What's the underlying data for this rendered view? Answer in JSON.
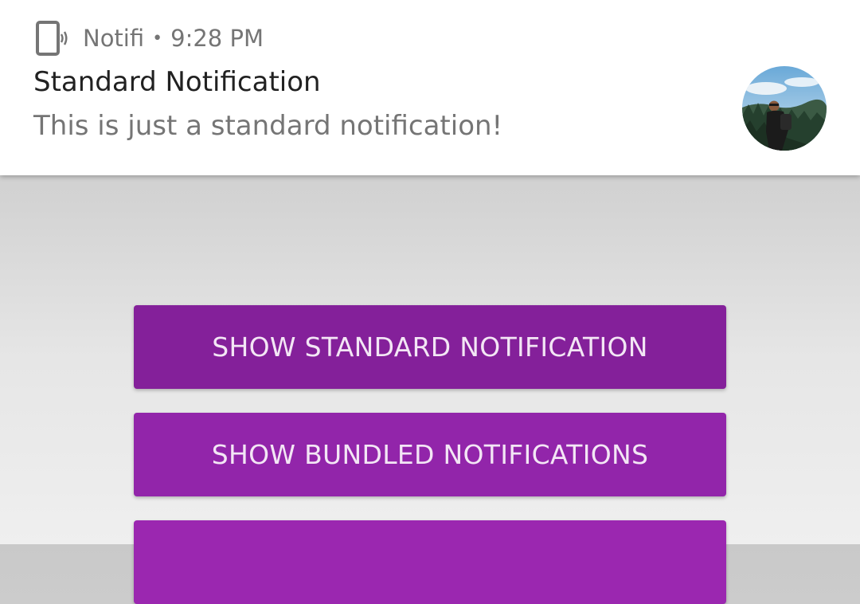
{
  "notification": {
    "app_name": "Notifi",
    "separator": "•",
    "time": "9:28 PM",
    "title": "Standard Notification",
    "text": "This is just a standard notification!",
    "app_icon": "phone-vibrate-icon",
    "large_icon": "avatar-photo"
  },
  "buttons": [
    {
      "label": "SHOW STANDARD NOTIFICATION"
    },
    {
      "label": "SHOW BUNDLED NOTIFICATIONS"
    },
    {
      "label": ""
    }
  ],
  "colors": {
    "button_primary": "#9b27b0",
    "notification_background": "#ffffff",
    "secondary_text": "#757575",
    "primary_text": "#212121"
  }
}
